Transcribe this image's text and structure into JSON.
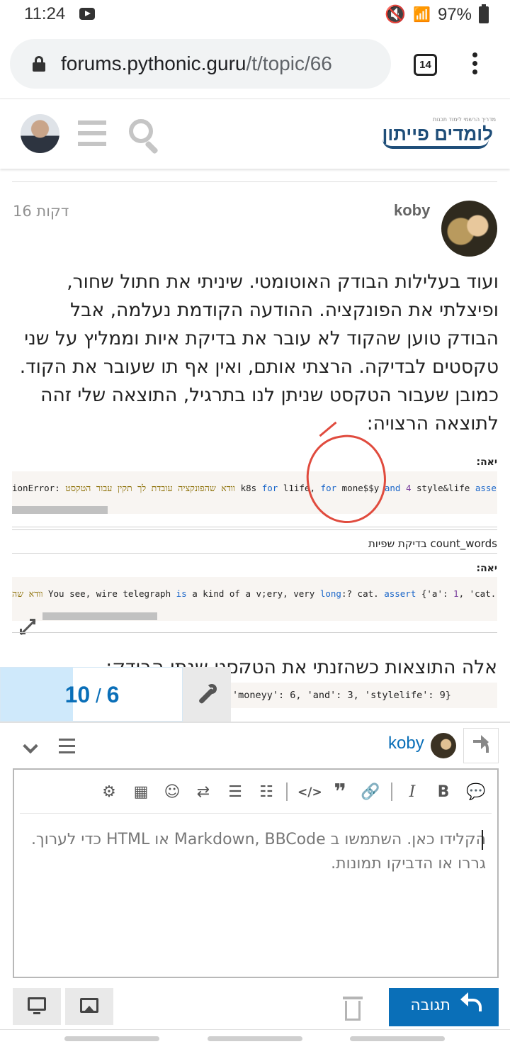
{
  "status_bar": {
    "time": "11:24",
    "battery": "97%"
  },
  "browser": {
    "url_host": "forums.pythonic.guru",
    "url_path": "/t/topic/66",
    "tab_count": "14"
  },
  "site": {
    "logo_tagline": "מדריך הרשמי לימוד תכנות",
    "logo_text": "לומדים פייתון"
  },
  "post": {
    "author": "koby",
    "time_ago": "16 דקות",
    "paragraph": "ועוד בעלילות הבודק האוטומטי. שיניתי את חתול שחור, ופיצלתי את הפונקציה. ההודעה הקודמת נעלמה, אבל הבודק טוען שהקוד לא עובר את בדיקת איות וממליץ על שני טקסטים לבדיקה. הרצתי אותם, ואין אף תו שעובר את הקוד. כמובן שעבור הטקסט שניתן לנו בתרגיל, התוצאה שלי זהה לתוצאה הרצויה:",
    "code_label_1": "יאה:",
    "code_line_1_parts": [
      "ionError: ",
      "וודא שהפונקציה עובדת לך תקין עבור הטקסט",
      " k8s ",
      "for",
      " l1ife, ",
      "for",
      " mone$$y ",
      "and",
      " ",
      "4",
      " style&life ",
      "assert",
      " {'"
    ],
    "section_title": "count_words בדיקת שפיות",
    "code_label_2": "יאה:",
    "code_line_2_parts": [
      "וודא שה",
      " You see, wire telegraph ",
      "is",
      " a kind of a v;ery, very ",
      "long",
      ":? cat. ",
      "assert",
      " {'a': ",
      "1",
      ", 'cat...ki"
    ],
    "line_after": "אלה התוצאות כשהזנתי את הטקסט שנתן הבודק:",
    "peek_code": "'moneyy': 6, 'and': 3, 'stylelife': 9}"
  },
  "progress": {
    "current": "6",
    "total": "10",
    "fraction": 0.4
  },
  "composer": {
    "reply_to": "koby",
    "placeholder": "הקלידו כאן. השתמשו ב Markdown, BBCode או HTML כדי לערוך. גררו או הדביקו תמונות.",
    "reply_button": "תגובה"
  },
  "toolbar_icons": [
    "gear-icon",
    "calendar-icon",
    "emoji-icon",
    "rtl-toggle-icon",
    "ordered-list-icon",
    "bullet-list-icon",
    "code-icon",
    "quote-icon",
    "link-icon",
    "italic-icon",
    "bold-icon",
    "speech-bubble-icon"
  ],
  "colors": {
    "accent": "#0a6fb8",
    "progress_fill": "#cfe9fb",
    "annotation": "#e04b3e"
  }
}
